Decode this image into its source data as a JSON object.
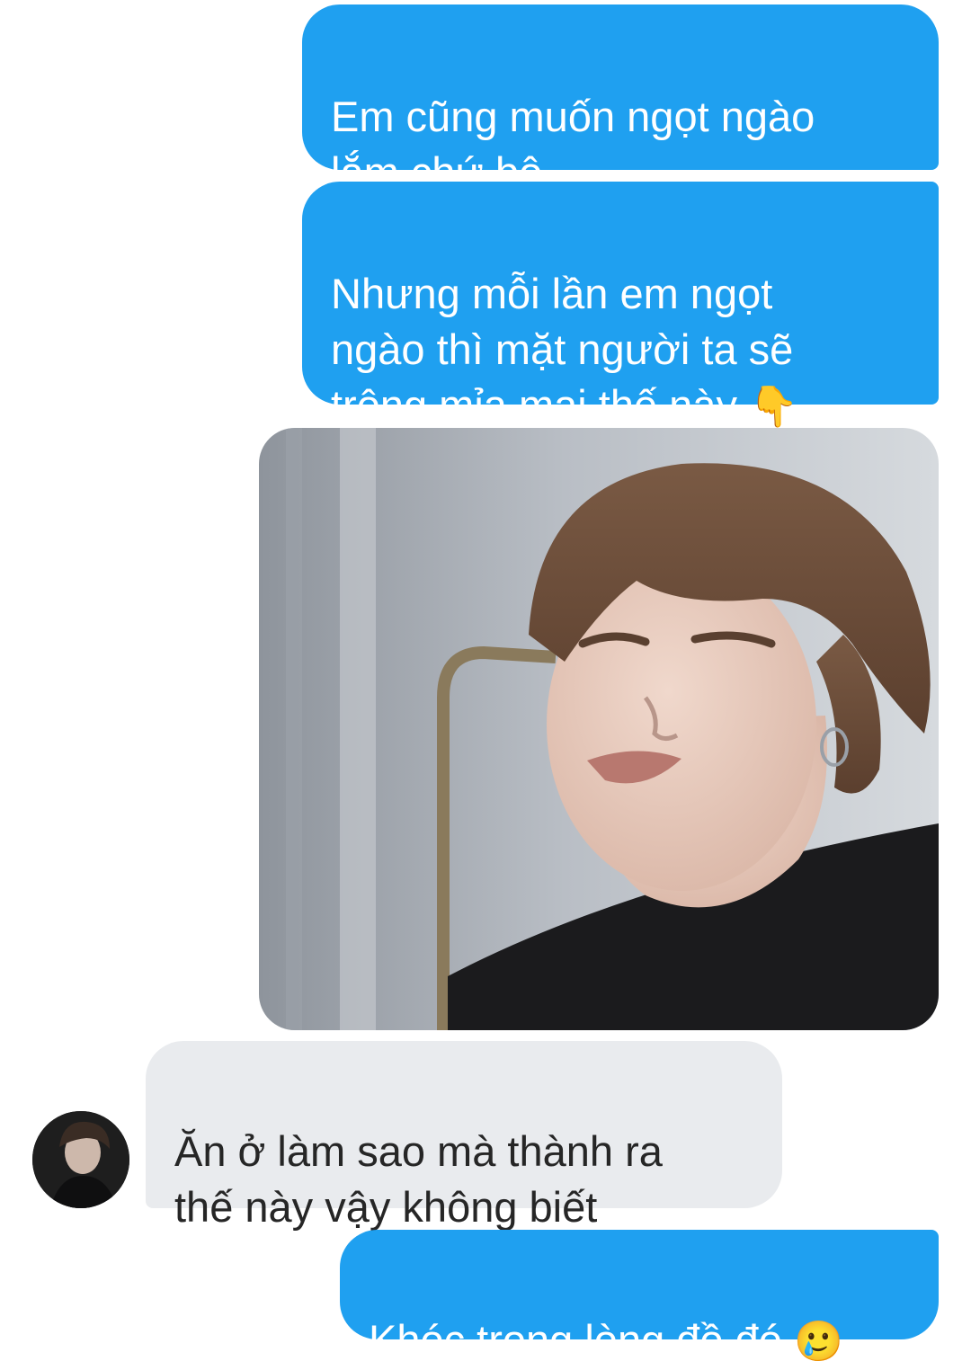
{
  "conversation": {
    "messages": [
      {
        "sender": "me",
        "text": "Em cũng muốn ngọt ngào\nlắm chứ bộ"
      },
      {
        "sender": "me",
        "text": "Nhưng mỗi lần em ngọt\nngào thì mặt người ta sẽ\ntrông mỉa mai thế này ",
        "emoji": "👇"
      },
      {
        "sender": "me",
        "type": "image"
      },
      {
        "sender": "other",
        "text": "Ăn ở làm sao mà thành ra\nthế này vậy không biết"
      },
      {
        "sender": "me",
        "text": "Khóc trong lòng đồ đó ",
        "emoji": "🥲"
      }
    ]
  },
  "colors": {
    "sent_bubble": "#1fa0f0",
    "received_bubble": "#e9ebee"
  }
}
